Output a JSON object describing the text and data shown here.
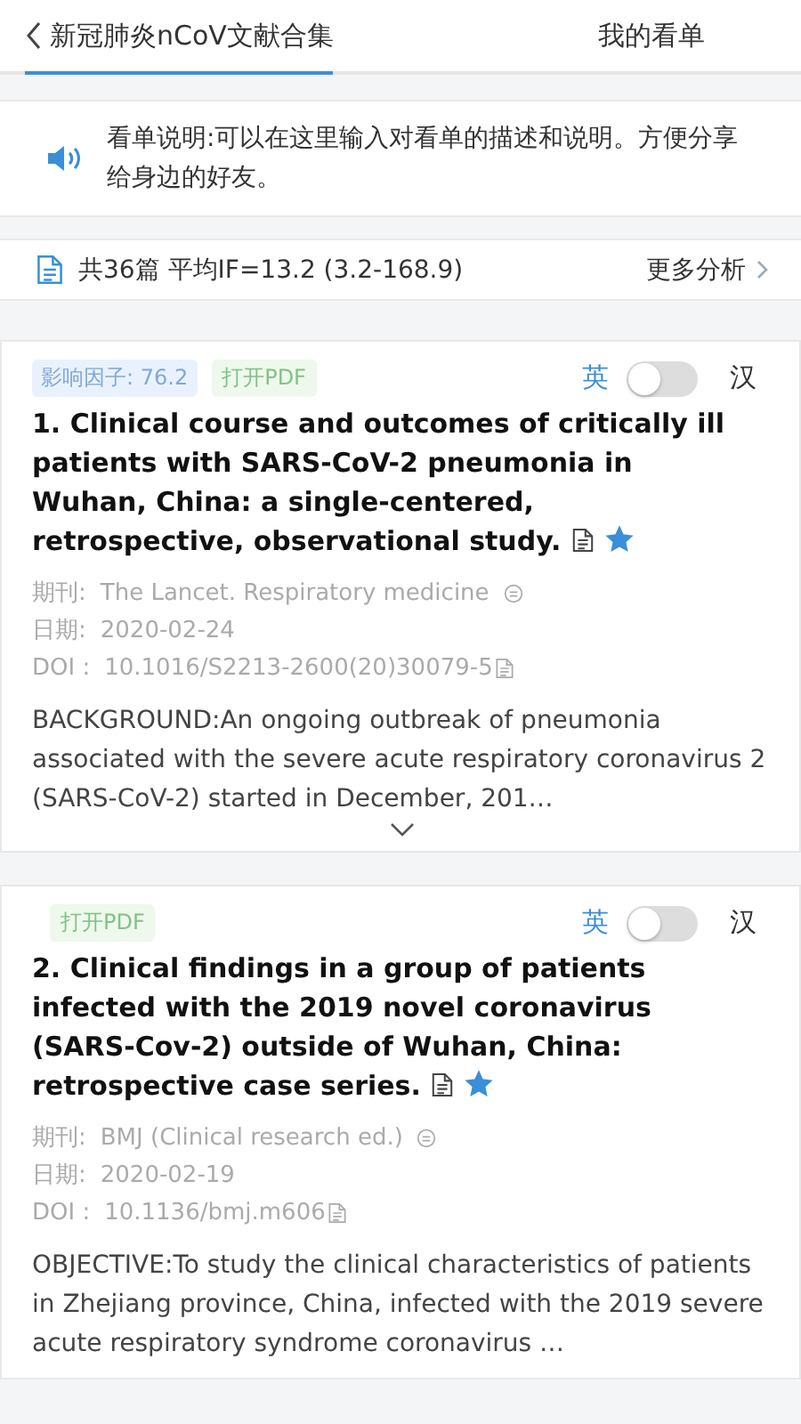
{
  "tabs": [
    {
      "label": "新冠肺炎nCoV文献合集",
      "selected": true,
      "kind": "back"
    },
    {
      "label": "我的看单",
      "selected": false,
      "kind": "plain"
    }
  ],
  "description": {
    "text": "看单说明:可以在这里输入对看单的描述和说明。方便分享给身边的好友。"
  },
  "summary": {
    "text": "共36篇 平均IF=13.2 (3.2-168.9)",
    "link": "更多分析"
  },
  "articles": [
    {
      "impact": "影响因子: 76.2",
      "pdf": "打开PDF",
      "lang_en": "英",
      "lang_zh": "汉",
      "translated": false,
      "title": "1. Clinical course and outcomes of critically ill patients with SARS-CoV-2 pneumonia in Wuhan, China: a single-centered, retrospective, observational study.",
      "starred": true,
      "journal_label": "期刊:",
      "journal": "The Lancet. Respiratory medicine",
      "date_label": "日期:",
      "date": "2020-02-24",
      "doi_label": "DOI :",
      "doi": "10.1016/S2213-2600(20)30079-5",
      "abstract": "BACKGROUND:An ongoing outbreak of pneumonia associated with the severe acute respiratory coronavirus 2 (SARS-CoV-2) started in December, 201…",
      "expandable": true
    },
    {
      "pdf": "打开PDF",
      "lang_en": "英",
      "lang_zh": "汉",
      "translated": false,
      "title": "2. Clinical findings in a group of patients infected with the 2019 novel coronavirus (SARS-Cov-2) outside of Wuhan, China: retrospective case series.",
      "starred": true,
      "journal_label": "期刊:",
      "journal": "BMJ (Clinical research ed.)",
      "date_label": "日期:",
      "date": "2020-02-19",
      "doi_label": "DOI :",
      "doi": "10.1136/bmj.m606",
      "abstract": "OBJECTIVE:To study the clinical characteristics of patients in Zhejiang province, China, infected with the 2019 severe acute respiratory syndrome coronavirus …",
      "expandable": false
    }
  ]
}
